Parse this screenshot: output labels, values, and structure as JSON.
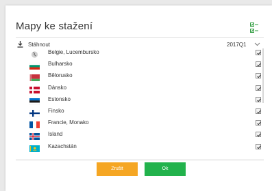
{
  "dialog": {
    "title": "Mapy ke stažení",
    "select_all_icon": "select-all-icon"
  },
  "list": {
    "header_label": "Stáhnout",
    "version": "2017Q1",
    "download_icon": "download-icon",
    "chevron_icon": "chevron-down-icon"
  },
  "maps": [
    {
      "name": "Belgie, Lucembursko",
      "flag": "eu-globe",
      "checked": true
    },
    {
      "name": "Bulharsko",
      "flag": "bulgaria",
      "checked": true
    },
    {
      "name": "Bělorusko",
      "flag": "belarus",
      "checked": true
    },
    {
      "name": "Dánsko",
      "flag": "denmark",
      "checked": true
    },
    {
      "name": "Estonsko",
      "flag": "estonia",
      "checked": true
    },
    {
      "name": "Finsko",
      "flag": "finland",
      "checked": true
    },
    {
      "name": "Francie, Monako",
      "flag": "france",
      "checked": true
    },
    {
      "name": "Island",
      "flag": "iceland",
      "checked": true
    },
    {
      "name": "Kazachstán",
      "flag": "kazakhstan",
      "checked": true
    }
  ],
  "buttons": {
    "cancel_label": "Zrušit",
    "ok_label": "Ok"
  },
  "colors": {
    "cancel": "#f5a623",
    "ok": "#22b24c",
    "select_icon": "#2e9b3e"
  }
}
